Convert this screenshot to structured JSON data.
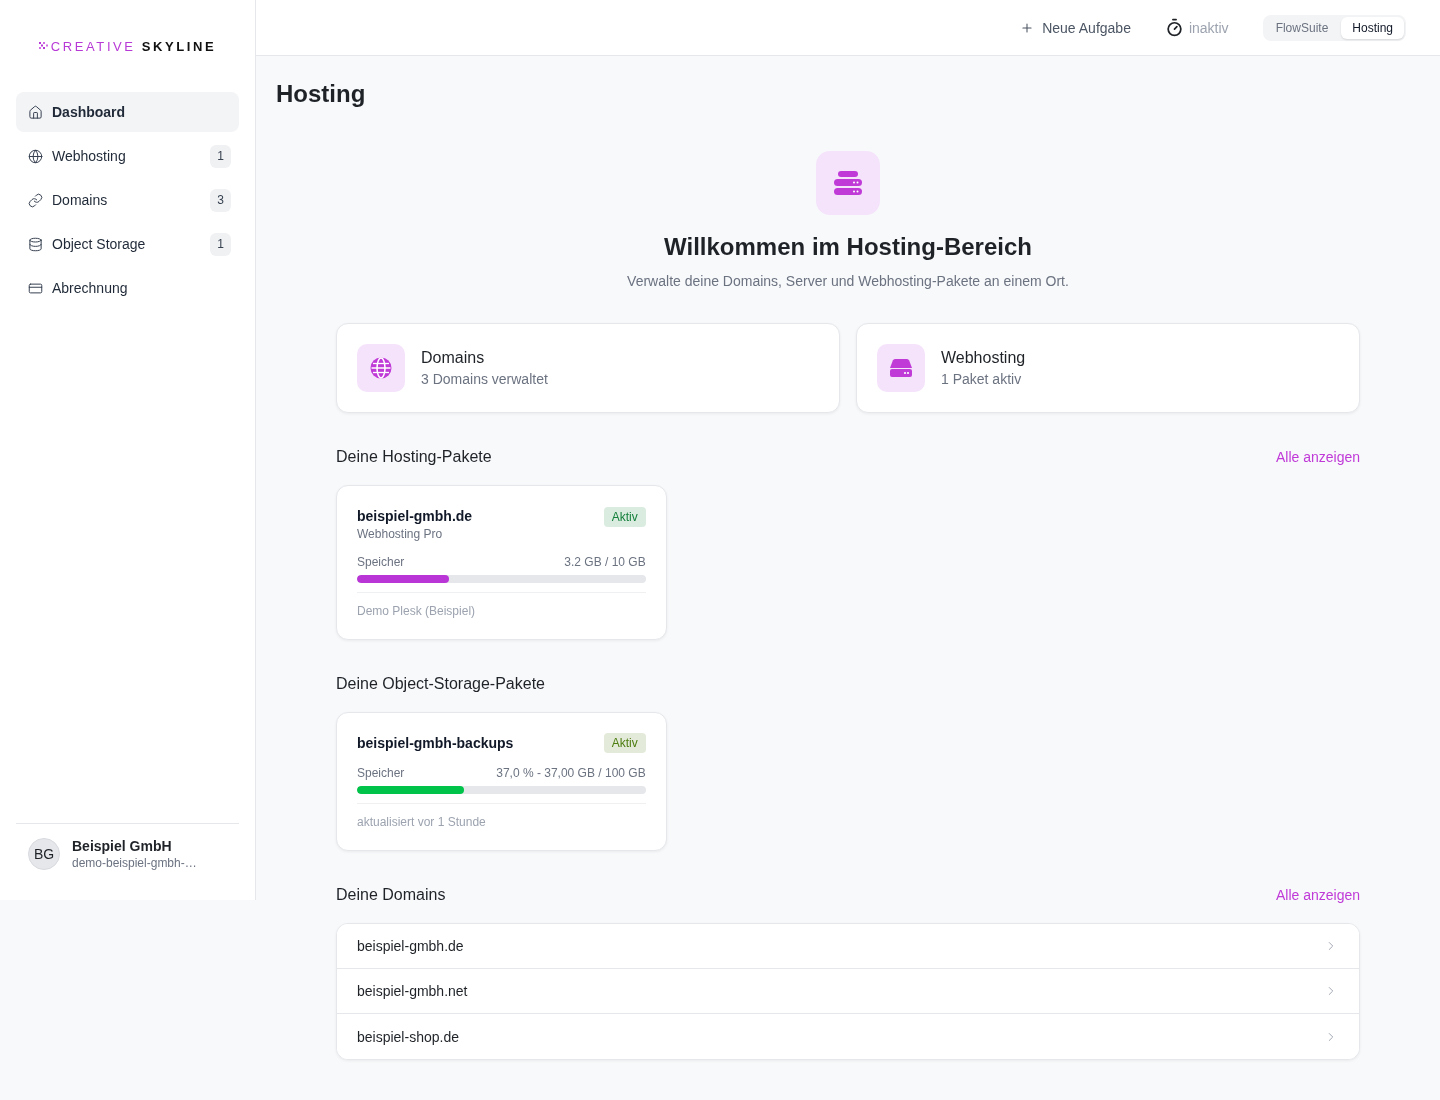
{
  "sidebar": {
    "logo": {
      "primary": "CREATIVE",
      "secondary": "SKYLINE"
    },
    "items": [
      {
        "kind": "home",
        "label": "Dashboard",
        "selected": true
      },
      {
        "kind": "web",
        "label": "Webhosting",
        "count": "1",
        "selected": false
      },
      {
        "kind": "domains",
        "label": "Domains",
        "count": "3",
        "selected": false
      },
      {
        "kind": "storage",
        "label": "Object Storage",
        "count": "1",
        "selected": false
      },
      {
        "kind": "billing",
        "label": "Abrechnung",
        "selected": false
      }
    ],
    "account": {
      "initials": "BG",
      "name": "Beispiel GmbH",
      "subtitle": "demo-beispiel-gmbh-…"
    }
  },
  "topbar": {
    "new_task": "Neue Aufgabe",
    "timer": "inaktiv",
    "app_switch": [
      {
        "label": "FlowSuite",
        "selected": false
      },
      {
        "label": "Hosting",
        "selected": true
      }
    ]
  },
  "page": {
    "title": "Hosting"
  },
  "hero": {
    "title": "Willkommen im Hosting-Bereich",
    "subtitle": "Verwalte deine Domains, Server und Webhosting-Pakete an einem Ort."
  },
  "summary_cards": [
    {
      "kind": "domains",
      "title": "Domains",
      "subtitle": "3 Domains verwaltet"
    },
    {
      "kind": "webhosting",
      "title": "Webhosting",
      "subtitle": "1 Paket aktiv"
    }
  ],
  "hosting_section": {
    "title": "Deine Hosting-Pakete",
    "link": "Alle anzeigen",
    "packages": [
      {
        "name": "beispiel-gmbh.de",
        "plan": "Webhosting Pro",
        "status": {
          "label": "Aktiv",
          "color": "#15803d"
        },
        "usage": {
          "label": "Speicher",
          "reading": "3.2 GB / 10 GB",
          "level": 0.32,
          "color": "#b935d6"
        },
        "note": "Demo Plesk (Beispiel)"
      }
    ]
  },
  "storage_section": {
    "title": "Deine Object-Storage-Pakete",
    "packages": [
      {
        "name": "beispiel-gmbh-backups",
        "status": {
          "label": "Aktiv",
          "color": "#4d7c0f"
        },
        "usage": {
          "label": "Speicher",
          "reading": "37,0 % - 37,00 GB / 100 GB",
          "level": 0.37,
          "color": "#00c34a"
        },
        "note": "aktualisiert vor 1 Stunde"
      }
    ]
  },
  "domains_section": {
    "title": "Deine Domains",
    "link": "Alle anzeigen",
    "domains": [
      {
        "name": "beispiel-gmbh.de"
      },
      {
        "name": "beispiel-gmbh.net"
      },
      {
        "name": "beispiel-shop.de"
      }
    ]
  }
}
